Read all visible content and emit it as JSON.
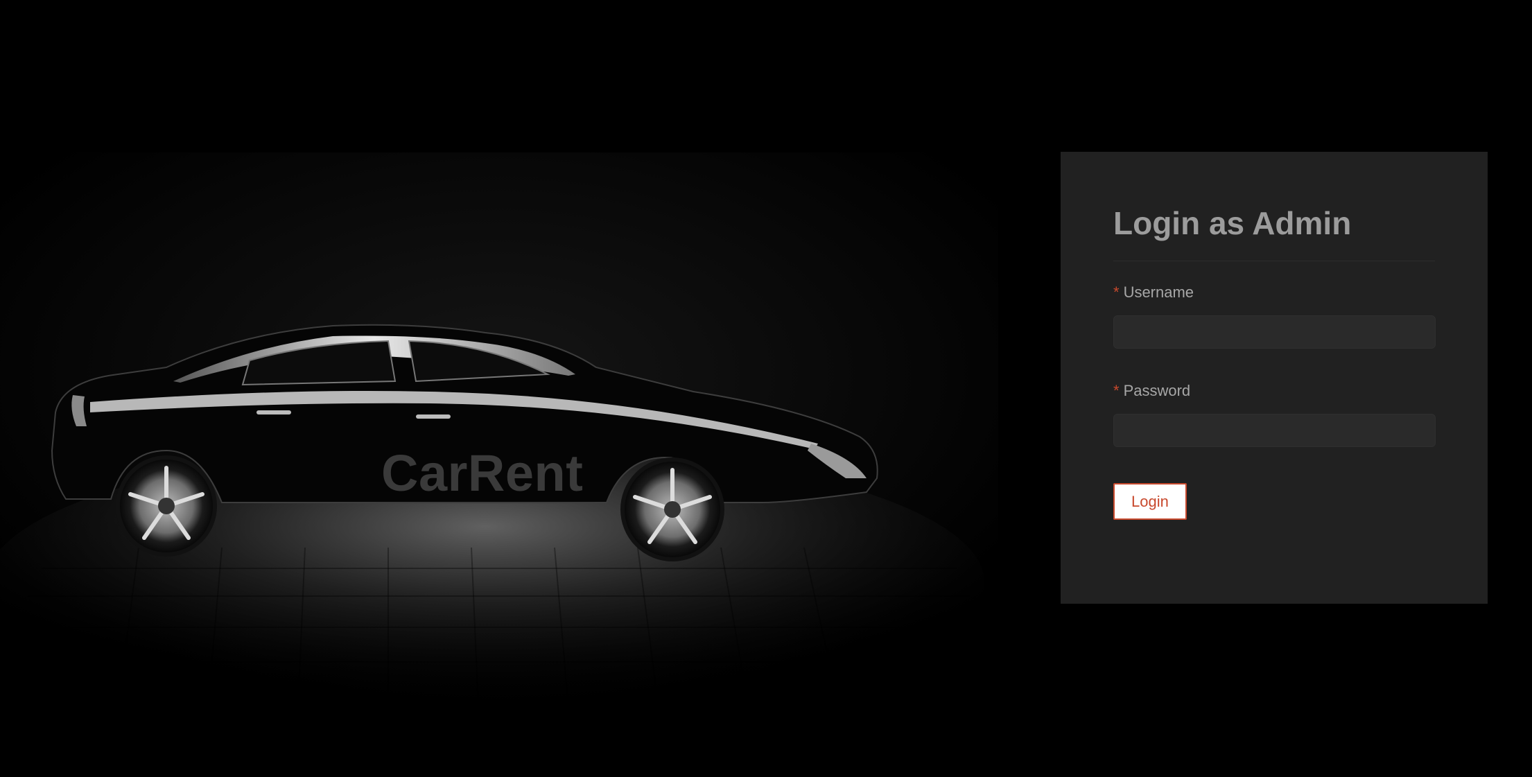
{
  "hero": {
    "brand_name": "CarRent",
    "image_description_icon": "car-silhouette-icon"
  },
  "login": {
    "title": "Login as Admin",
    "required_marker": "*",
    "username_label": "Username",
    "username_value": "",
    "password_label": "Password",
    "password_value": "",
    "submit_label": "Login"
  },
  "colors": {
    "page_background": "#000000",
    "panel_background": "#212121",
    "accent": "#c8492d",
    "input_background": "#2a2a2a",
    "title_text": "#9c9c9c",
    "brand_text": "#3a3a3a"
  }
}
